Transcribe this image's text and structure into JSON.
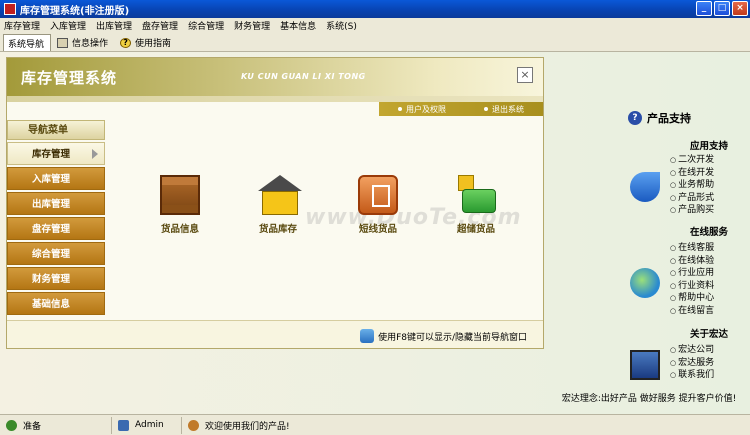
{
  "window": {
    "title": "库存管理系统(非注册版)"
  },
  "menu": [
    "库存管理",
    "入库管理",
    "出库管理",
    "盘存管理",
    "综合管理",
    "财务管理",
    "基本信息",
    "系统(S)"
  ],
  "toolbar": {
    "tabs": [
      "系统导航",
      "信息操作",
      "使用指南"
    ]
  },
  "panel": {
    "title": "库存管理系统",
    "pinyin": "KU CUN GUAN LI XI TONG",
    "links": [
      "用户及权限",
      "退出系统"
    ],
    "close_label": "×"
  },
  "nav": {
    "header": "导航菜单",
    "items": [
      "库存管理",
      "入库管理",
      "出库管理",
      "盘存管理",
      "综合管理",
      "财务管理",
      "基础信息"
    ]
  },
  "features": [
    "货品信息",
    "货品库存",
    "短线货品",
    "超储货品"
  ],
  "watermark": "www.DuoTe.com",
  "footer_hint": "使用F8键可以显示/隐藏当前导航窗口",
  "support": {
    "title": "产品支持",
    "app_support": {
      "title": "应用支持",
      "items": [
        "二次开发",
        "在线开发",
        "业务帮助",
        "产品形式",
        "产品购买"
      ]
    },
    "online_service": {
      "title": "在线服务",
      "items": [
        "在线客服",
        "在线体验",
        "行业应用",
        "行业资料",
        "帮助中心",
        "在线留言"
      ]
    },
    "about": {
      "title": "关于宏达",
      "items": [
        "宏达公司",
        "宏达服务",
        "联系我们"
      ]
    },
    "slogan": "宏达理念:出好产品 做好服务 提升客户价值!"
  },
  "status": {
    "ready": "准备",
    "user": "Admin",
    "welcome": "欢迎使用我们的产品!"
  },
  "colors": {
    "title_bar": "#0842b0",
    "nav_item": "#b47614",
    "accent": "#c2a630"
  }
}
